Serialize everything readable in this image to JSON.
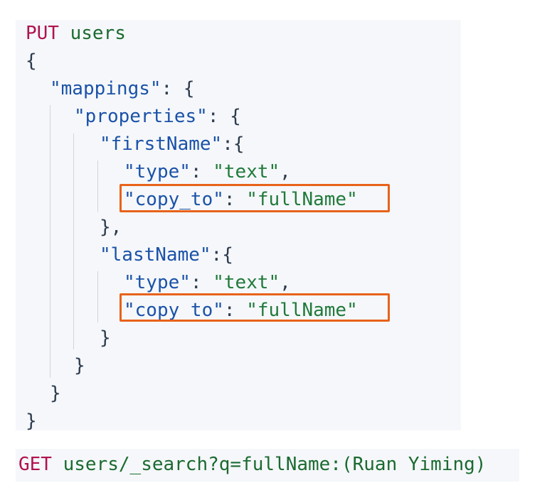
{
  "request": {
    "method": "PUT",
    "index": "users"
  },
  "mapping": {
    "open_brace": "{",
    "mappings_key": "\"mappings\"",
    "properties_key": "\"properties\"",
    "first_name_key": "\"firstName\"",
    "last_name_key": "\"lastName\"",
    "type_key": "\"type\"",
    "type_value": "\"text\"",
    "copy_to_key": "\"copy_to\"",
    "copy_to_value": "\"fullName\"",
    "colon_space": ": ",
    "colon_brace": ": {",
    "colon_brace_tight": ":{",
    "comma": ",",
    "close_brace": "}",
    "close_brace_comma": "},"
  },
  "query": {
    "method": "GET",
    "path": "users/_search?q=fullName:(Ruan Yiming)"
  },
  "colors": {
    "highlight": "#e8621a",
    "method": "#b0124f",
    "key": "#1a52a8",
    "string": "#207a3a",
    "panel": "#f5f7fa"
  }
}
